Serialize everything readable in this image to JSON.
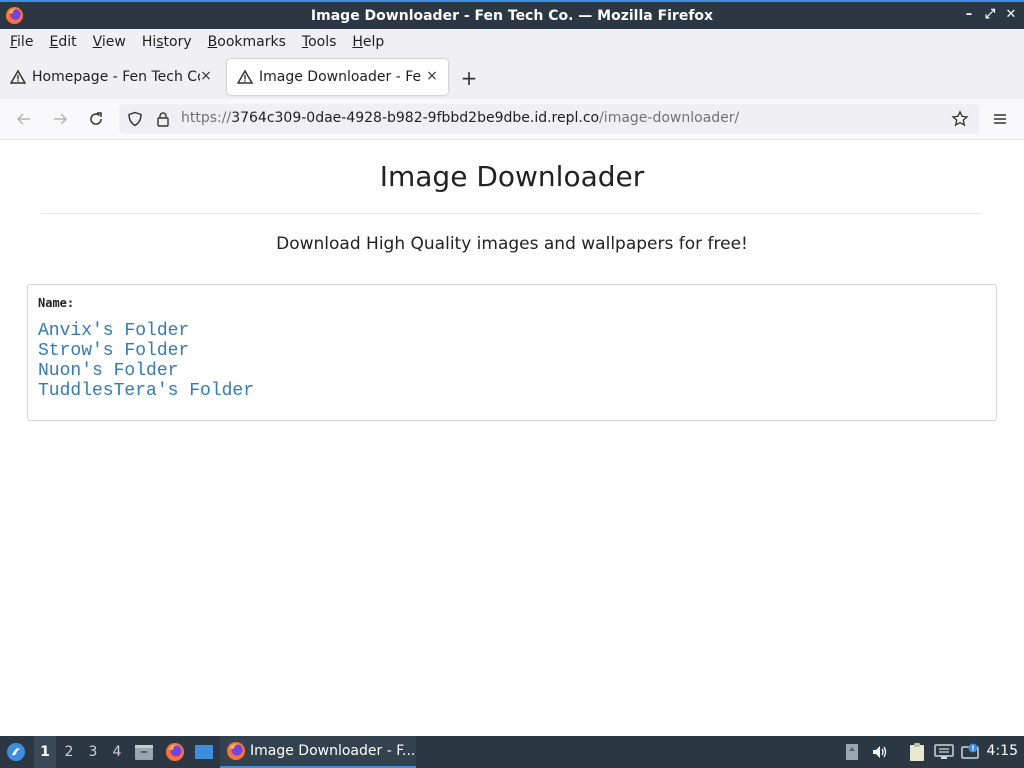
{
  "window": {
    "title": "Image Downloader - Fen Tech Co. — Mozilla Firefox",
    "controls": {
      "minimize": "–",
      "maximize": "⤢",
      "close": "✕"
    }
  },
  "menu": [
    {
      "u": "F",
      "rest": "ile"
    },
    {
      "u": "E",
      "rest": "dit"
    },
    {
      "u": "V",
      "rest": "iew"
    },
    {
      "pre": "Hi",
      "u": "s",
      "rest": "tory"
    },
    {
      "u": "B",
      "rest": "ookmarks"
    },
    {
      "u": "T",
      "rest": "ools"
    },
    {
      "u": "H",
      "rest": "elp"
    }
  ],
  "tabs": [
    {
      "label": "Homepage - Fen Tech Co.",
      "active": false
    },
    {
      "label": "Image Downloader - Fen",
      "active": true
    }
  ],
  "tab_close": "×",
  "new_tab": "+",
  "url": {
    "host": "https://3764c309-0dae-4928-b982-9fbbd2be9dbe.id.repl.co",
    "path": "/image-downloader/",
    "scheme_part": "https://",
    "domain_part": "3764c309-0dae-4928-b982-9fbbd2be9dbe.id.repl.co"
  },
  "page": {
    "title": "Image Downloader",
    "subtitle": "Download High Quality images and wallpapers for free!",
    "name_header": "Name:",
    "folders": [
      "Anvix's Folder",
      "Strow's Folder",
      "Nuon's Folder",
      "TuddlesTera's Folder"
    ]
  },
  "taskbar": {
    "workspaces": [
      "1",
      "2",
      "3",
      "4"
    ],
    "active_workspace": "1",
    "active_task": "Image Downloader - F...",
    "clock": "4:15"
  },
  "colors": {
    "link": "#337ab7",
    "titlebar": "#2b3844",
    "accent": "#3d8ee0"
  }
}
